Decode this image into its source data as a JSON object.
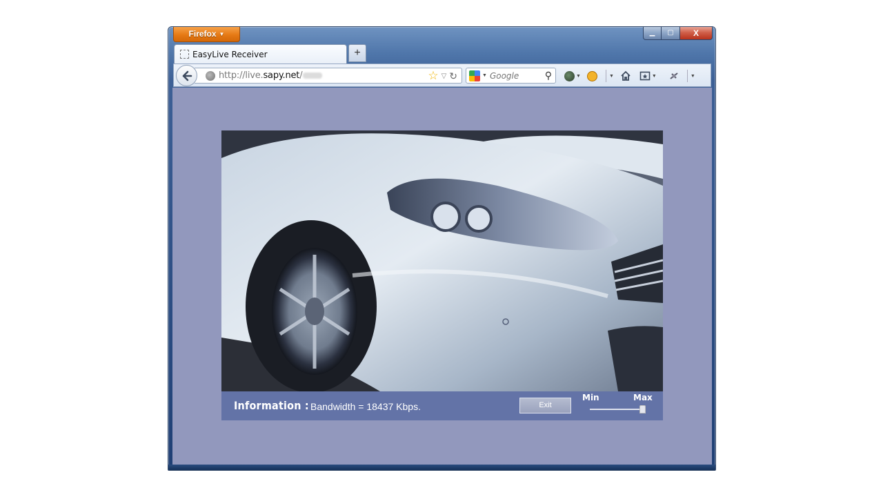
{
  "browser": {
    "app_button_label": "Firefox",
    "caption": {
      "minimize": "▁",
      "maximize": "▢",
      "close": "X"
    },
    "tab": {
      "title": "EasyLive Receiver"
    },
    "new_tab_label": "+",
    "url": {
      "prefix": "http://live.",
      "host": "sapy.net",
      "suffix": "/"
    },
    "search": {
      "placeholder": "Google"
    },
    "icons": [
      "back-arrow-icon",
      "globe-icon",
      "bookmark-star-icon",
      "history-dropdown-icon",
      "reload-icon",
      "google-icon",
      "search-magnifier-icon",
      "addon-globe-icon",
      "smiley-addon-icon",
      "home-icon",
      "bookmarks-menu-icon",
      "extension-icon",
      "overflow-menu-icon"
    ]
  },
  "player": {
    "info_label": "Information :",
    "bandwidth_text": "Bandwidth = 18437 Kbps.",
    "exit_label": "Exit",
    "slider": {
      "min_label": "Min",
      "max_label": "Max",
      "level": 1.0
    }
  },
  "colors": {
    "page_background": "#9298bd",
    "info_bar": "#6373a7",
    "firefox_orange": "#e67a15"
  }
}
